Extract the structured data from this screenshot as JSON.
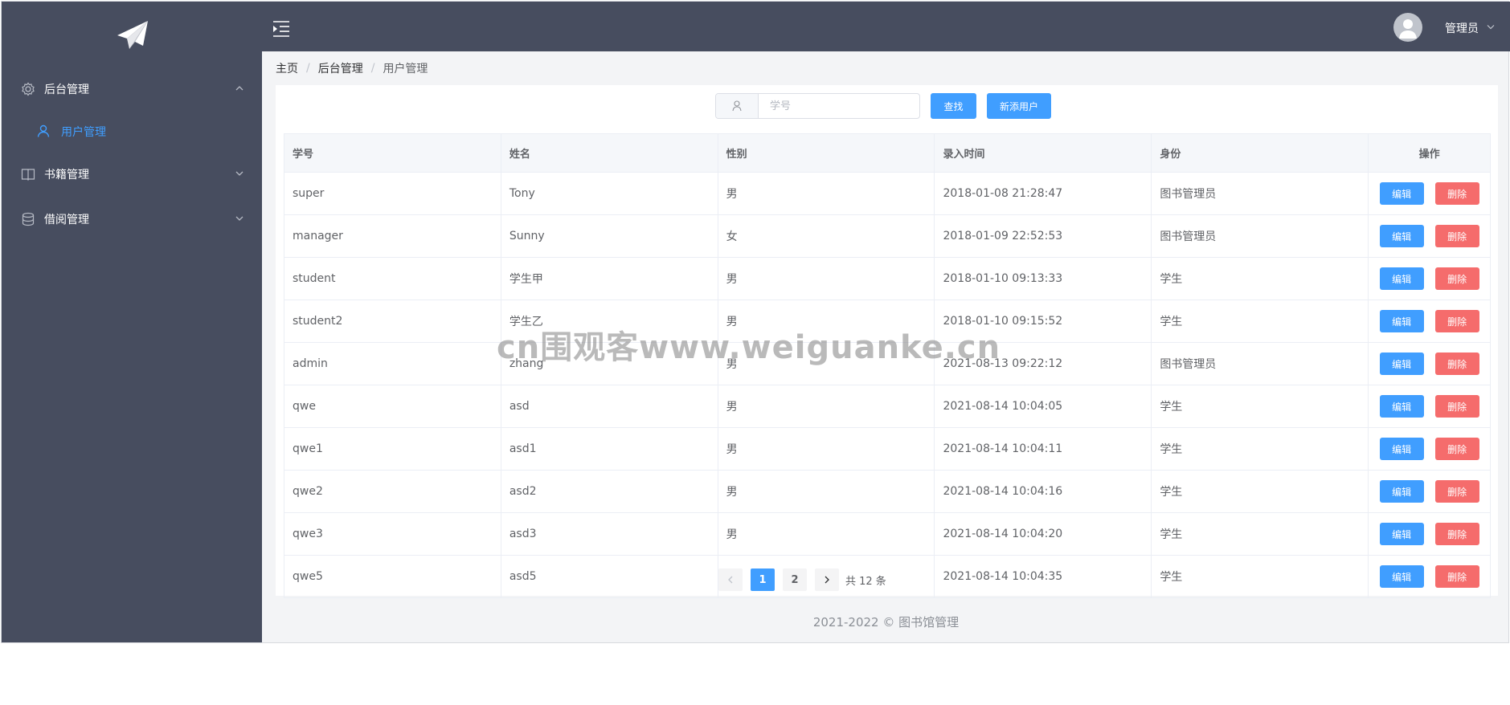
{
  "sidebar": {
    "logo": "paper-plane-logo",
    "menus": [
      {
        "label": "后台管理",
        "icon": "gear-icon",
        "expanded": true
      },
      {
        "label": "书籍管理",
        "icon": "book-icon",
        "expanded": false
      },
      {
        "label": "借阅管理",
        "icon": "database-icon",
        "expanded": false
      }
    ],
    "sub_items": [
      {
        "label": "用户管理",
        "icon": "user-icon",
        "active": true
      }
    ]
  },
  "header": {
    "toggle_icon": "menu-fold-icon",
    "user_name": "管理员"
  },
  "breadcrumb": [
    "主页",
    "后台管理",
    "用户管理"
  ],
  "search": {
    "placeholder": "学号",
    "search_label": "查找",
    "add_label": "新添用户"
  },
  "table": {
    "headers": [
      "学号",
      "姓名",
      "性别",
      "录入时间",
      "身份",
      "操作"
    ],
    "edit_label": "编辑",
    "delete_label": "删除",
    "rows": [
      [
        "super",
        "Tony",
        "男",
        "2018-01-08 21:28:47",
        "图书管理员"
      ],
      [
        "manager",
        "Sunny",
        "女",
        "2018-01-09 22:52:53",
        "图书管理员"
      ],
      [
        "student",
        "学生甲",
        "男",
        "2018-01-10 09:13:33",
        "学生"
      ],
      [
        "student2",
        "学生乙",
        "男",
        "2018-01-10 09:15:52",
        "学生"
      ],
      [
        "admin",
        "zhang",
        "男",
        "2021-08-13 09:22:12",
        "图书管理员"
      ],
      [
        "qwe",
        "asd",
        "男",
        "2021-08-14 10:04:05",
        "学生"
      ],
      [
        "qwe1",
        "asd1",
        "男",
        "2021-08-14 10:04:11",
        "学生"
      ],
      [
        "qwe2",
        "asd2",
        "男",
        "2021-08-14 10:04:16",
        "学生"
      ],
      [
        "qwe3",
        "asd3",
        "男",
        "2021-08-14 10:04:20",
        "学生"
      ],
      [
        "qwe5",
        "asd5",
        "",
        "2021-08-14 10:04:35",
        "学生"
      ]
    ]
  },
  "pagination": {
    "pages": [
      "1",
      "2"
    ],
    "current": "1",
    "total_text": "共 12 条"
  },
  "watermark": "cn围观客www.weiguanke.cn",
  "footer": "2021-2022 © 图书馆管理",
  "colors": {
    "sidebar_bg": "#474d5f",
    "primary": "#409eff",
    "danger": "#f56c6c"
  }
}
